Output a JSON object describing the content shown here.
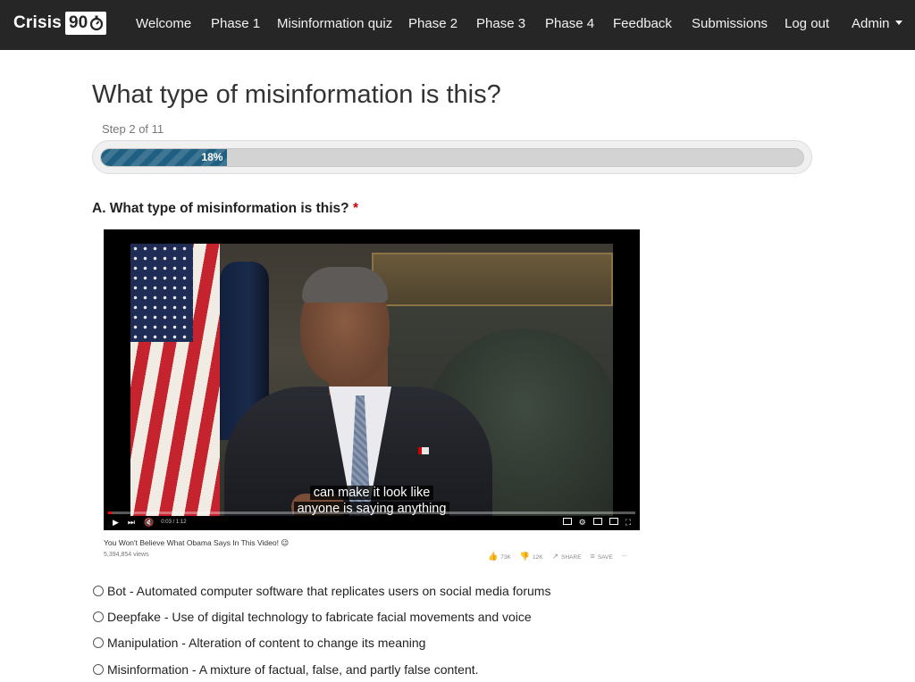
{
  "nav": {
    "brand_text": "Crisis",
    "brand_number": "90",
    "items": [
      "Welcome",
      "Phase 1",
      "Misinformation quiz",
      "Phase 2",
      "Phase 3",
      "Phase 4",
      "Feedback",
      "Submissions",
      "Log out"
    ],
    "admin_label": "Admin"
  },
  "page": {
    "title": "What type of misinformation is this?",
    "step": "Step 2 of 11",
    "progress_label": "18%",
    "progress_value": 18
  },
  "question": {
    "label": "A. What type of misinformation is this?",
    "required_mark": "*"
  },
  "video": {
    "subtitle_line1": "can make it look like",
    "subtitle_line2": "anyone is saying anything",
    "time": "0:03 / 1:12",
    "title": "You Won't Believe What Obama Says In This Video! 😉",
    "views": "5,394,854 views",
    "likes": "73K",
    "dislikes": "12K",
    "share": "SHARE",
    "save": "SAVE",
    "more": "..."
  },
  "options": [
    "Bot - Automated computer software that replicates users on social media forums",
    "Deepfake - Use of digital technology to fabricate facial movements and voice",
    "Manipulation - Alteration of content to change its meaning",
    "Misinformation - A mixture of factual, false, and partly false content."
  ],
  "colors": {
    "navbar": "#262626",
    "progress_fill": "#1f5f82",
    "required": "#cc0000"
  }
}
